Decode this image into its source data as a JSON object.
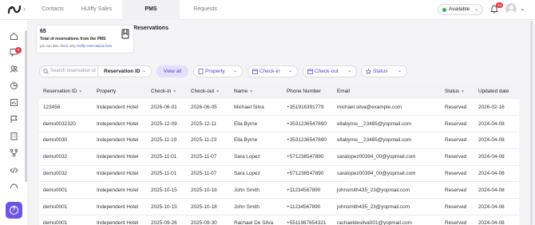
{
  "nav": {
    "tabs": [
      "Contacts",
      "HiJiffy Sales",
      "PMS Reservations",
      "Requests"
    ],
    "active_tab": "PMS Reservations"
  },
  "topbar": {
    "status_label": "Available",
    "status_color": "#2fb35c",
    "notification_count": "34",
    "icons": [
      "hijiffy-logo-icon",
      "bell-icon",
      "avatar",
      "chevron-down-icon"
    ]
  },
  "sidebar": {
    "icons": [
      "home-icon",
      "chat-icon",
      "contacts-icon",
      "analytics-icon",
      "reports-icon",
      "flag-icon",
      "building-icon",
      "flow-icon",
      "code-icon",
      "integrations-icon",
      "help-icon"
    ],
    "chat_badge": "9"
  },
  "summary": {
    "count": "65",
    "label_prefix": "Total of reservations",
    "label_suffix": "from the PMS",
    "link_prefix": "you can also check only",
    "link_text": "HiJiffy reservations here"
  },
  "filters": {
    "search_placeholder": "Search reservation id",
    "field_select": "Reservation ID",
    "view_all": "View all",
    "property": "Property",
    "check_in": "Check-in",
    "check_out": "Check-out",
    "status": "Status"
  },
  "table": {
    "columns": [
      "Reservation ID",
      "Property",
      "Check-in",
      "Check-out",
      "Name",
      "Phone Number",
      "Email",
      "Status",
      "Updated date"
    ],
    "rows": [
      [
        "123456",
        "Independent Hotel",
        "2026-06-01",
        "2026-06-05",
        "Michael Silva",
        "+351916391779",
        "michael.silva@example.com",
        "Reserved",
        "2026-02-16"
      ],
      [
        "demo0032320",
        "Independent Hotel",
        "2025-12-09",
        "2025-12-11",
        "Ella Byrne",
        "+3531236547890",
        "ellabyrne__23485@yopmail.com",
        "Reserved",
        "2024-04-08"
      ],
      [
        "demo0030",
        "Independent Hotel",
        "2025-11-19",
        "2025-11-23",
        "Ella Byrne",
        "+3531236547890",
        "ellabyrne__23485@yopmail.com",
        "Reserved",
        "2024-04-08"
      ],
      [
        "demo0032",
        "Independent Hotel",
        "2025-11-01",
        "2025-11-07",
        "Sara Lopez",
        "+571236547890",
        "saralopez00394_00@yopmail.com",
        "Reserved",
        "2024-04-08"
      ],
      [
        "demo0032",
        "Independent Hotel",
        "2025-11-01",
        "2025-11-07",
        "Sara Lopez",
        "+571236547890",
        "saralopez00394_00@yopmail.com",
        "Reserved",
        "2024-04-08"
      ],
      [
        "demo0001",
        "Independent Hotel",
        "2025-10-15",
        "2025-10-18",
        "John Smith",
        "+11234567890",
        "johnsmith435_23@yopmail.com",
        "Reserved",
        "2024-04-08"
      ],
      [
        "demo0001",
        "Independent Hotel",
        "2025-10-15",
        "2025-10-18",
        "John Smith",
        "+11234567890",
        "johnsmith435_23@yopmail.com",
        "Reserved",
        "2024-04-08"
      ],
      [
        "demo0001",
        "Independent Hotel",
        "2025-09-26",
        "2025-09-30",
        "Rachael De Silva",
        "+5511987654321",
        "rachaeldesilva001@yopmail.com",
        "Reserved",
        "2024-04-08"
      ]
    ]
  }
}
